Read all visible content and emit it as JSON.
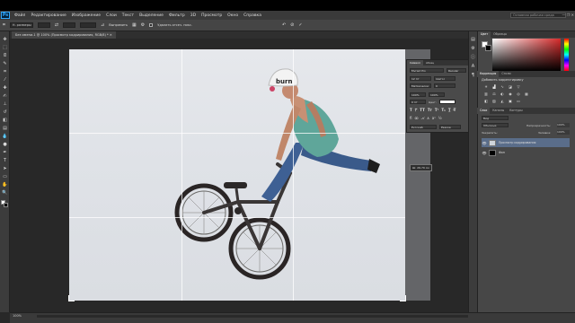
{
  "app": {
    "logo": "Ps"
  },
  "menu": {
    "items": [
      "Файл",
      "Редактирование",
      "Изображение",
      "Слои",
      "Текст",
      "Выделение",
      "Фильтр",
      "3D",
      "Просмотр",
      "Окно",
      "Справка"
    ],
    "search_placeholder": "Основная рабочая среда",
    "window_controls": "— ❐ ✕"
  },
  "options": {
    "ratio": "Н. размеры",
    "straighten": "Выпрямить",
    "delete_cropped": "Удалить отсеч. пикс.",
    "icons": [
      "crop-tool-icon",
      "swap-icon",
      "grid-overlay-icon",
      "settings-icon",
      "undo-icon",
      "cancel-icon",
      "commit-icon"
    ]
  },
  "document": {
    "tab_title": "Без имени-1 @ 100% (Просмотр кадрирования, RGB/8) * ✕"
  },
  "canvas": {
    "tooltip_size": "Ш: 26,79 см",
    "helmet_text": "burn"
  },
  "character_panel": {
    "tabs": [
      "Символ",
      "Абзац"
    ],
    "font": "Myriad Pro",
    "style": "Regular",
    "size": "12 пт",
    "leading": "(Авто)",
    "tracking": "Метрически",
    "kerning": "0",
    "scale_v": "100%",
    "scale_h": "100%",
    "baseline": "0 пт",
    "color_label": "Цвет:",
    "language": "Русский",
    "aa": "Резкое"
  },
  "color_panel": {
    "tabs": [
      "Цвет",
      "Образцы"
    ],
    "fg_color": "#ffffff",
    "bg_color": "#000000",
    "accent": "#d62b2b"
  },
  "adjustments_panel": {
    "tabs": [
      "Коррекция",
      "Стили"
    ],
    "title": "Добавить корректировку"
  },
  "layers_panel": {
    "tabs": [
      "Слои",
      "Каналы",
      "Контуры"
    ],
    "kind_filter": "Вид",
    "blend_mode": "Обычные",
    "opacity_label": "Непрозрачность:",
    "opacity": "100%",
    "lock_label": "Закрепить:",
    "fill_label": "Заливка:",
    "fill": "100%",
    "layers": [
      {
        "name": "Просмотр кадрирования",
        "selected": true
      },
      {
        "name": "Фон",
        "selected": false
      }
    ]
  },
  "status": {
    "zoom": "100%"
  }
}
